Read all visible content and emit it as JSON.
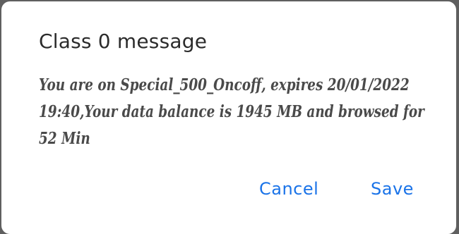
{
  "dialog": {
    "title": "Class 0 message",
    "message": "You are on Special_500_Oncoff, expires 20/01/2022 19:40,Your data balance is 1945 MB and browsed for 52 Min",
    "buttons": {
      "cancel": "Cancel",
      "save": "Save"
    }
  },
  "colors": {
    "accent": "#1a73e8",
    "scrim": "#5f5f5f",
    "surface": "#ffffff"
  }
}
